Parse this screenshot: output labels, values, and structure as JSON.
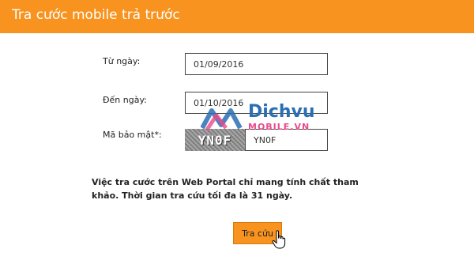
{
  "header": {
    "title": "Tra cước mobile trả trước"
  },
  "form": {
    "from_label": "Từ ngày:",
    "from_value": "01/09/2016",
    "to_label": "Đến ngày:",
    "to_value": "01/10/2016",
    "captcha_label": "Mã bảo mật*:",
    "captcha_image_text": "YN0F",
    "captcha_value": "YN0F"
  },
  "notice": "Việc tra cước trên Web Portal chỉ mang tính chất tham khảo. Thời gian tra cứu tối đa là 31 ngày.",
  "search_button": {
    "label": "Tra cứu"
  },
  "watermark": {
    "top": "Dichvu",
    "bottom": "MOBILE.VN"
  },
  "colors": {
    "header": "#f7931e",
    "button": "#f7931e",
    "watermark_blue": "#2a6fb3",
    "watermark_pink": "#e84a8a"
  },
  "icons": {
    "cursor": "hand-pointer-icon"
  }
}
